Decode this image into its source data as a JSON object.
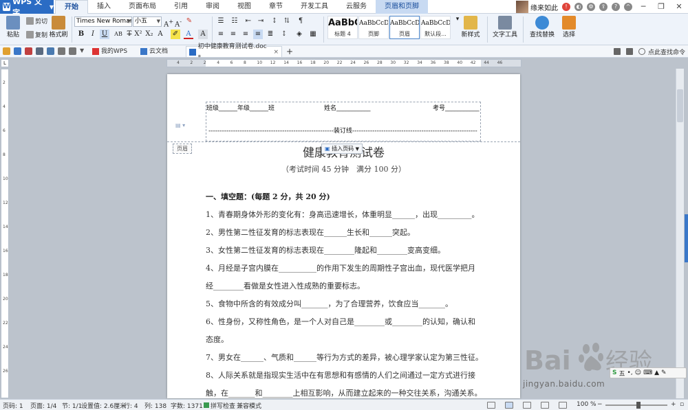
{
  "titlebar": {
    "app_name": "WPS 文字",
    "menu_tabs": [
      "开始",
      "插入",
      "页面布局",
      "引用",
      "审阅",
      "视图",
      "章节",
      "开发工具",
      "云服务",
      "页眉和页脚"
    ],
    "user_name": "缘来如此"
  },
  "ribbon": {
    "paste": "粘贴",
    "cut": "剪切",
    "copy": "复制",
    "format_painter": "格式刷",
    "font_name": "Times New Roman",
    "font_size": "小五",
    "styles": [
      {
        "sample": "AaBbC",
        "label": "标题 4"
      },
      {
        "sample": "AaBbCcDd",
        "label": "页脚"
      },
      {
        "sample": "AaBbCcDd",
        "label": "页眉"
      },
      {
        "sample": "AaBbCcDd",
        "label": "默认段..."
      }
    ],
    "new_style": "新样式",
    "text_tools": "文字工具",
    "find_replace": "查找替换",
    "select": "选择"
  },
  "quickbar": {
    "tabs": [
      "我的WPS",
      "云文档",
      "初中健康教育测试卷.doc *"
    ],
    "search_cmd": "点此查找命令"
  },
  "ruler": {
    "h_ticks": [
      "4",
      "2",
      "2",
      "4",
      "6",
      "8",
      "10",
      "12",
      "14",
      "16",
      "18",
      "20",
      "22",
      "24",
      "26",
      "28",
      "30",
      "32",
      "34",
      "36",
      "38",
      "40",
      "42",
      "44",
      "46"
    ],
    "v_ticks": [
      "2",
      "4",
      "6",
      "8",
      "10",
      "12",
      "14",
      "16",
      "18",
      "20",
      "22",
      "24",
      "26"
    ]
  },
  "document": {
    "header_fields": [
      "班级______年级______班",
      "姓名___________",
      "考号___________"
    ],
    "binding_line": "--------------------------------------------------------装订线--------------------------------------------------------",
    "header_tag": "页眉",
    "insert_page_number": "插入页码",
    "title": "健康教育测试卷",
    "subtitle": "（考试时间 45 分钟　满分 100 分）",
    "paragraphs": [
      "一、填空题：(每题 2 分，共 20 分)",
      "1、青春期身体外形的变化有：身高迅速增长，体重明显______，出现_________。",
      "2、男性第二性征发育的标志表现在______生长和______突起。",
      "3、女性第二性征发育的标志表现在________隆起和________变高变细。",
      "4、月经是子宫内膜在__________的作用下发生的周期性子宫出血，现代医学把月",
      "经________看做是女性进入性成熟的重要标志。",
      "5、食物中所含的有效成分叫_______，为了合理营养，饮食应当_______。",
      "6、性身份，又称性角色，是一个人对自己是________或________的认知，确认和",
      "态度。",
      "7、男女在______、气质和______等行为方式的差异，被心理学家认定为第三性征。",
      "8、人际关系就是指现实生活中在有思想和有感情的人们之间通过一定方式进行接",
      "触，在_______和________上相互影响，从而建立起来的一种交往关系，沟通关系。"
    ]
  },
  "statusbar": {
    "page_code": "页码: 1",
    "page": "页面: 1/4",
    "section": "节: 1/1",
    "setting": "设置值: 2.6厘米",
    "row": "行: 4",
    "col": "列: 138",
    "word_count": "字数: 1371",
    "spell": "拼写检查",
    "compat": "兼容模式",
    "zoom": "100 %"
  },
  "watermark": {
    "text": "jingyan.baidu.com"
  },
  "colors": {
    "accent": "#2b6cc4",
    "ribbon_bg": "#eef3fa",
    "workspace": "#bcc3cc"
  }
}
